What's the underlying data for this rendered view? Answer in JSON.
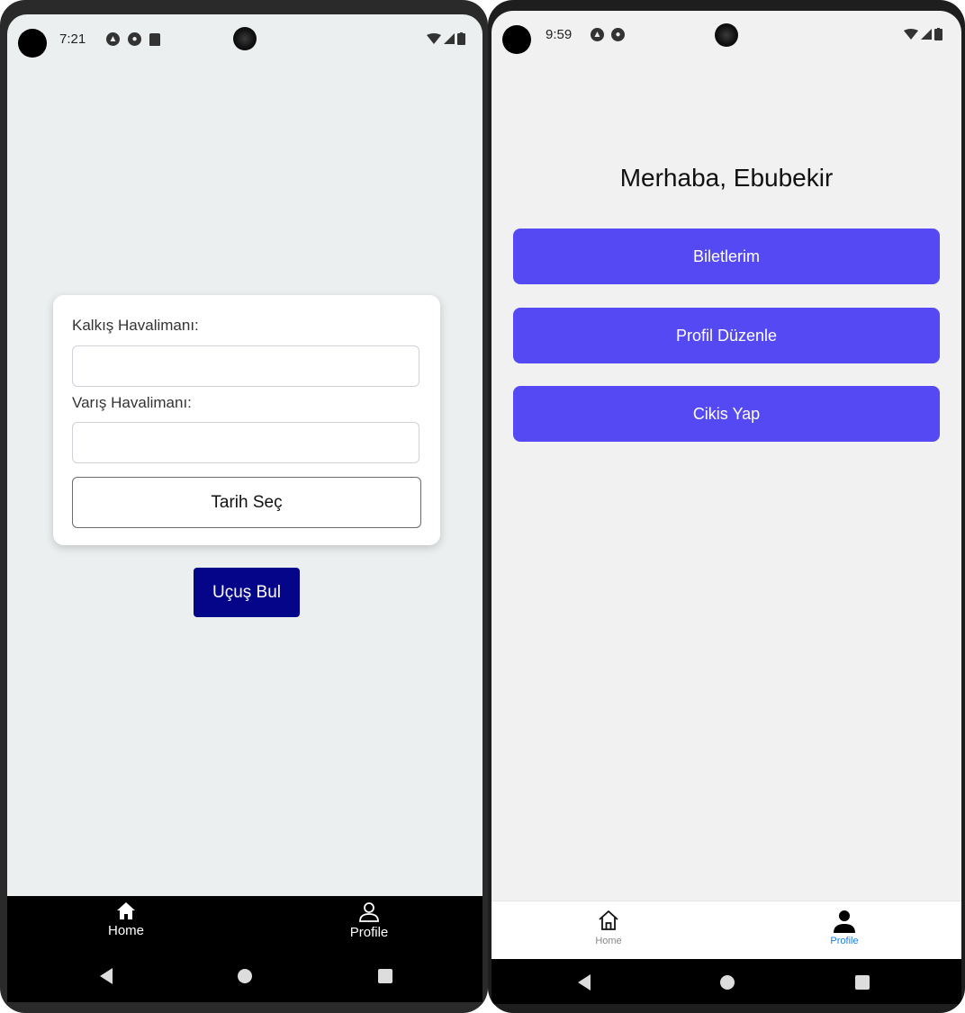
{
  "left": {
    "status": {
      "time": "7:21"
    },
    "form": {
      "departure_label": "Kalkış Havalimanı:",
      "departure_value": "",
      "arrival_label": "Varış Havalimanı:",
      "arrival_value": "",
      "date_button": "Tarih Seç"
    },
    "find_button": "Uçuş Bul",
    "tabs": [
      {
        "label": "Home",
        "icon": "home-filled-icon"
      },
      {
        "label": "Profile",
        "icon": "person-outline-icon"
      }
    ],
    "colors": {
      "find_button": "#05058a",
      "background": "#eceff0",
      "tab_bar": "#000000"
    }
  },
  "right": {
    "status": {
      "time": "9:59"
    },
    "greeting": "Merhaba,  Ebubekir",
    "buttons": [
      "Biletlerim",
      "Profil Düzenle",
      "Cikis Yap"
    ],
    "tabs": [
      {
        "label": "Home",
        "icon": "home-outline-icon"
      },
      {
        "label": "Profile",
        "icon": "person-filled-icon",
        "active": true
      }
    ],
    "colors": {
      "buttons": "#5549f4",
      "active_tab": "#1e7fe0",
      "background": "#f1f1f1"
    }
  }
}
